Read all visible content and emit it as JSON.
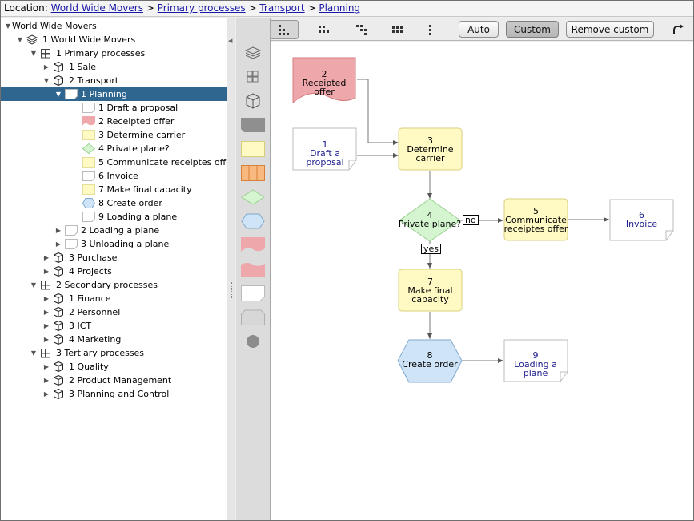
{
  "location": {
    "label": "Location:",
    "crumbs": [
      "World Wide Movers",
      "Primary processes",
      "Transport",
      "Planning"
    ],
    "separator": ">"
  },
  "tree": {
    "items": [
      {
        "label": "World Wide Movers"
      },
      {
        "label": "1 World Wide Movers"
      },
      {
        "label": "1 Primary processes"
      },
      {
        "label": "1 Sale"
      },
      {
        "label": "2 Transport"
      },
      {
        "label": "1 Planning"
      },
      {
        "label": "1 Draft a proposal"
      },
      {
        "label": "2 Receipted offer"
      },
      {
        "label": "3 Determine carrier"
      },
      {
        "label": "4 Private plane?"
      },
      {
        "label": "5 Communicate receiptes offer"
      },
      {
        "label": "6 Invoice"
      },
      {
        "label": "7 Make final capacity"
      },
      {
        "label": "8 Create order"
      },
      {
        "label": "9 Loading a plane"
      },
      {
        "label": "2 Loading a plane"
      },
      {
        "label": "3 Unloading a plane"
      },
      {
        "label": "3 Purchase"
      },
      {
        "label": "4 Projects"
      },
      {
        "label": "2 Secondary processes"
      },
      {
        "label": "1 Finance"
      },
      {
        "label": "2 Personnel"
      },
      {
        "label": "3 ICT"
      },
      {
        "label": "4 Marketing"
      },
      {
        "label": "3 Tertiary processes"
      },
      {
        "label": "1 Quality"
      },
      {
        "label": "2 Product Management"
      },
      {
        "label": "3 Planning and Control"
      }
    ]
  },
  "toolbar": {
    "auto_label": "Auto",
    "custom_label": "Custom",
    "remove_custom_label": "Remove custom"
  },
  "diagram": {
    "nodes": {
      "n2": {
        "num": "2",
        "text": "Receipted offer"
      },
      "n1": {
        "num": "1",
        "text": "Draft a proposal"
      },
      "n3": {
        "num": "3",
        "text1": "Determine",
        "text2": "carrier"
      },
      "n4": {
        "num": "4",
        "text": "Private plane?"
      },
      "n5": {
        "num": "5",
        "text1": "Communicate",
        "text2": "receiptes offer"
      },
      "n6": {
        "num": "6",
        "text": "Invoice"
      },
      "n7": {
        "num": "7",
        "text1": "Make final",
        "text2": "capacity"
      },
      "n8": {
        "num": "8",
        "text": "Create order"
      },
      "n9": {
        "num": "9",
        "text": "Loading a plane"
      }
    },
    "edge_labels": {
      "no": "no",
      "yes": "yes"
    }
  },
  "colors": {
    "selection": "#2f6690",
    "link": "#1a1aa6",
    "process_fill": "#fff9c4",
    "process_stroke": "#d8cf7a",
    "decision_fill": "#d4f5cf",
    "decision_stroke": "#9ccf93",
    "event_fill": "#cfe4f7",
    "event_stroke": "#7fa9cf",
    "offer_fill": "#eea7aa",
    "doc_text": "#1a1a8c"
  }
}
